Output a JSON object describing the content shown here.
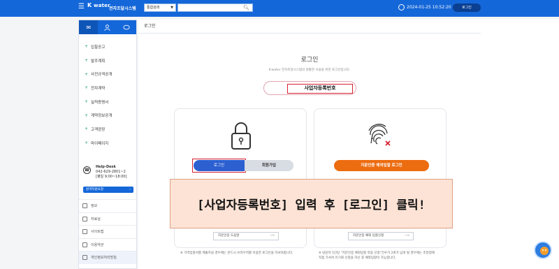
{
  "topbar": {
    "logo_k": "K",
    "logo_rest": "water",
    "system_title": "전자조달시스템",
    "search_scope": "통합검색",
    "datetime": "2024-01-25 10:52:20",
    "login_label": "로그인"
  },
  "sidebar": {
    "menu": [
      {
        "label": "입찰공고"
      },
      {
        "label": "발주계획"
      },
      {
        "label": "사전규격공개"
      },
      {
        "label": "전자계약"
      },
      {
        "label": "실적증명서"
      },
      {
        "label": "계약정보공개"
      },
      {
        "label": "고객광장"
      },
      {
        "label": "마이페이지"
      }
    ],
    "helpdesk": {
      "title": "Help-Desk",
      "phone": "042-629-2801~2",
      "hours": "[평일 9:00~18:00]"
    },
    "remote_support": "원격지원요청",
    "links": [
      {
        "label": "정보"
      },
      {
        "label": "자료실"
      },
      {
        "label": "사이트맵"
      },
      {
        "label": "이용약관"
      },
      {
        "label": "개인정보처리방침"
      }
    ]
  },
  "main": {
    "breadcrumb": "로그인",
    "title": "로그인",
    "subtitle": "K-water 전자조달시스템의 원활한 사용을 위한 로그인입니다.",
    "bizno_tab": "사업자등록번호",
    "login_button": "로그인",
    "signup_button": "회원가입",
    "finger_login_button": "지문인증 예외입찰 로그인",
    "guide_left": "지문인증 도움말",
    "guide_right": "지문인증 예외 입찰신청",
    "note_left": "※ 가격입찰서를 제출하실 경우에는 반드시 브라우저를 이용한 로그인을 하셔야합니다.",
    "note_right": "※ 담당자 1인당 \"지문인증 예외입찰 적용 신청\"건수가 2회가 넘게 될 경우에는 조달청에 직접 가셔서 유기화 신청을 하신 후 예외입찰이 가능합니다."
  },
  "overlay": {
    "text": "[사업자등록번호] 입력 후 [로그인] 클릭!"
  }
}
